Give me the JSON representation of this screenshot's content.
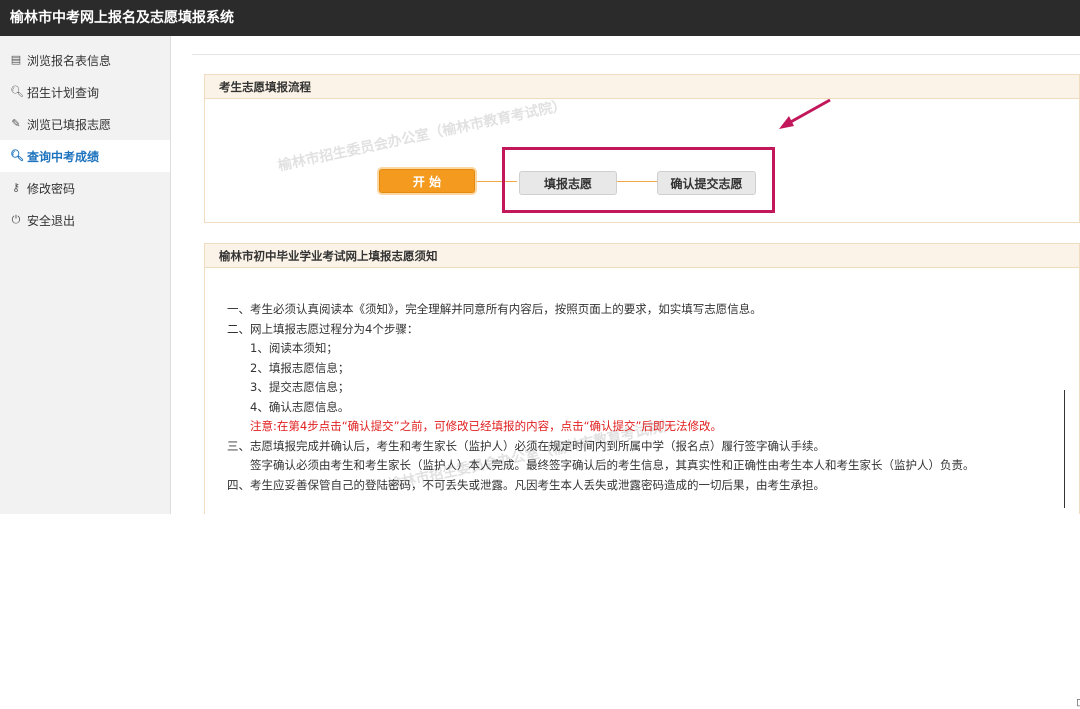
{
  "app": {
    "title": "榆林市中考网上报名及志愿填报系统"
  },
  "sidebar": {
    "items": [
      {
        "label": "浏览报名表信息",
        "icon": "document-icon",
        "glyph": "▤"
      },
      {
        "label": "招生计划查询",
        "icon": "search-icon",
        "glyph": "🔍︎"
      },
      {
        "label": "浏览已填报志愿",
        "icon": "pencil-icon",
        "glyph": "✎"
      },
      {
        "label": "查询中考成绩",
        "icon": "search-icon",
        "glyph": "🔍︎"
      },
      {
        "label": "修改密码",
        "icon": "key-icon",
        "glyph": "⚷"
      },
      {
        "label": "安全退出",
        "icon": "power-icon",
        "glyph": "⏻"
      }
    ],
    "active_index": 3
  },
  "flow_panel": {
    "title": "考生志愿填报流程",
    "start_label": "开 始",
    "step1_label": "填报志愿",
    "step2_label": "确认提交志愿",
    "watermark": "榆林市招生委员会办公室（榆林市教育考试院）"
  },
  "notice_panel": {
    "title": "榆林市初中毕业学业考试网上填报志愿须知",
    "lines": [
      "一、考生必须认真阅读本《须知》，完全理解并同意所有内容后，按照页面上的要求，如实填写志愿信息。",
      "二、网上填报志愿过程分为4个步骤：",
      "　　1、阅读本须知；",
      "　　2、填报志愿信息；",
      "　　3、提交志愿信息；",
      "　　4、确认志愿信息。"
    ],
    "warning": "　　注意:在第4步点击“确认提交”之前，可修改已经填报的内容，点击“确认提交”后即无法修改。",
    "lines2": [
      "三、志愿填报完成并确认后，考生和考生家长（监护人）必须在规定时间内到所属中学（报名点）履行签字确认手续。",
      "　　签字确认必须由考生和考生家长（监护人）本人完成。最终签字确认后的考生信息，其真实性和正确性由考生本人和考生家长（监护人）负责。",
      "四、考生应妥善保管自己的登陆密码，不可丢失或泄露。凡因考生本人丢失或泄露密码造成的一切后果，由考生承担。"
    ],
    "watermark": "榆林市招生委员会办公室（榆林市教育考试院）"
  },
  "colors": {
    "highlight": "#c2185b",
    "accent": "#f39a1f",
    "active_link": "#1e73be"
  }
}
